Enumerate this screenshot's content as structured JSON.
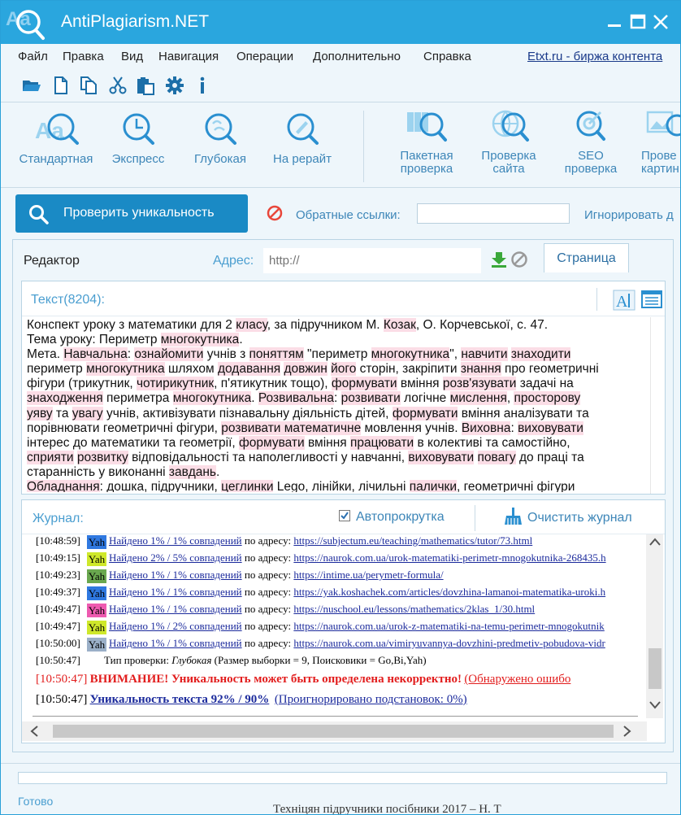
{
  "app": {
    "title": "AntiPlagiarism.NET",
    "accent": "#2aa6de"
  },
  "menu": {
    "items": [
      "Файл",
      "Правка",
      "Вид",
      "Навигация",
      "Операции",
      "Дополнительно",
      "Справка"
    ],
    "etxt_link": "Etxt.ru - биржа контента"
  },
  "toolbar_icons": [
    "open-folder-icon",
    "new-file-icon",
    "copy-icon",
    "cut-icon",
    "paste-icon",
    "gear-icon",
    "info-icon"
  ],
  "ribbon": {
    "left": [
      "Стандартная",
      "Экспресс",
      "Глубокая",
      "На рерайт"
    ],
    "right": [
      {
        "line1": "Пакетная",
        "line2": "проверка"
      },
      {
        "line1": "Проверка",
        "line2": "сайта"
      },
      {
        "line1": "SEO",
        "line2": "проверка"
      },
      {
        "line1": "Прове",
        "line2": "картин"
      }
    ]
  },
  "actions": {
    "check_button": "Проверить уникальность",
    "backlinks_label": "Обратные ссылки:",
    "backlinks_value": "",
    "ignore_label": "Игнорировать д"
  },
  "editor": {
    "tab_label": "Редактор",
    "address_label": "Адрес:",
    "address_placeholder": "http://",
    "page_tab": "Страница",
    "text_count": "Текст(8204):"
  },
  "journal": {
    "title": "Журнал:",
    "autoscroll_label": "Автопрокрутка",
    "autoscroll_checked": true,
    "clear_label": "Очистить журнал",
    "rows": [
      {
        "time": "[10:48:59]",
        "engine": "Yah",
        "badge": "#2f78e0",
        "found": "Найдено 1% / 1% совпадений",
        "via": "по адресу:",
        "url": "https://subjectum.eu/teaching/mathematics/tutor/73.html"
      },
      {
        "time": "[10:49:15]",
        "engine": "Yah",
        "badge": "#cfe82b",
        "found": "Найдено 2% / 5% совпадений",
        "via": "по адресу:",
        "url": "https://naurok.com.ua/urok-matematiki-perimetr-mnogokutnika-268435.h"
      },
      {
        "time": "[10:49:23]",
        "engine": "Yah",
        "badge": "#6aa84f",
        "found": "Найдено 1% / 1% совпадений",
        "via": "по адресу:",
        "url": "https://intime.ua/perymetr-formula/"
      },
      {
        "time": "[10:49:37]",
        "engine": "Yah",
        "badge": "#2f78e0",
        "found": "Найдено 1% / 1% совпадений",
        "via": "по адресу:",
        "url": "https://yak.koshachek.com/articles/dovzhina-lamanoi-matematika-uroki.h"
      },
      {
        "time": "[10:49:47]",
        "engine": "Yah",
        "badge": "#ee5ab0",
        "found": "Найдено 1% / 1% совпадений",
        "via": "по адресу:",
        "url": "https://nuschool.eu/lessons/mathematics/2klas_1/30.html"
      },
      {
        "time": "[10:49:47]",
        "engine": "Yah",
        "badge": "#cfe82b",
        "found": "Найдено 1% / 2% совпадений",
        "via": "по адресу:",
        "url": "https://naurok.com.ua/urok-z-matematiki-na-temu-perimetr-mnogokutnik"
      },
      {
        "time": "[10:50:00]",
        "engine": "Yah",
        "badge": "#9bb0c8",
        "found": "Найдено 1% / 1% совпадений",
        "via": "по адресу:",
        "url": "https://naurok.com.ua/vimiryuvannya-dovzhini-predmetiv-pobudova-vidr"
      }
    ],
    "check_type": {
      "time": "[10:50:47]",
      "label": "Тип проверки:",
      "value": "Глубокая",
      "details": "(Размер выборки = 9, Поисковики = Go,Bi,Yah)"
    },
    "warning": {
      "time": "[10:50:47]",
      "text": "ВНИМАНИЕ! Уникальность может быть определена некорректно!",
      "tail": "(Обнаружено ошибо"
    },
    "uniqueness": {
      "time": "[10:50:47]",
      "text": "Уникальность текста 92% / 90%",
      "ignored": "(Проигнорировано подстановок: 0%)"
    }
  },
  "status": {
    "text": "Готово"
  },
  "behind_window_text": "Техніцян підручники посібники 2017 – Н. Т"
}
